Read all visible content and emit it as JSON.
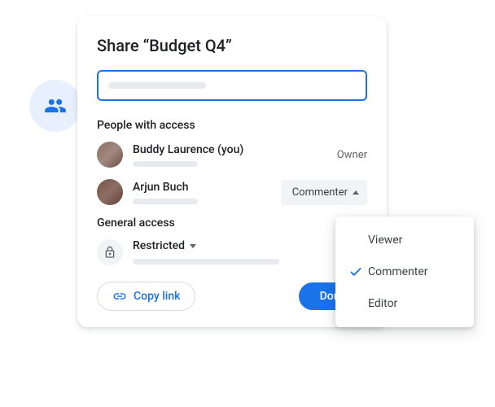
{
  "dialog": {
    "title": "Share “Budget Q4”",
    "input_placeholder": "",
    "sections": {
      "people_header": "People with access",
      "general_header": "General access"
    },
    "people": [
      {
        "name": "Buddy Laurence (you)",
        "role": "Owner"
      },
      {
        "name": "Arjun Buch",
        "role": "Commenter"
      }
    ],
    "general_access": {
      "label": "Restricted"
    },
    "footer": {
      "copy_link": "Copy link",
      "done": "Done"
    }
  },
  "dropdown": {
    "options": [
      {
        "label": "Viewer",
        "selected": false
      },
      {
        "label": "Commenter",
        "selected": true
      },
      {
        "label": "Editor",
        "selected": false
      }
    ]
  }
}
